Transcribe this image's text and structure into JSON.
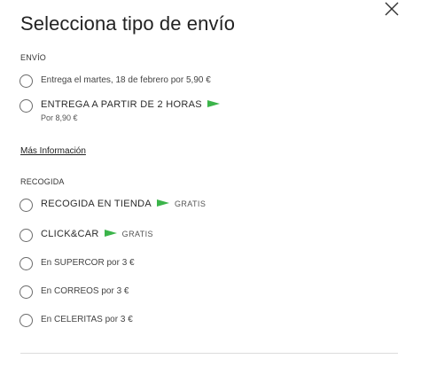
{
  "modal": {
    "title": "Selecciona tipo de envío",
    "close_icon": "close-icon"
  },
  "envio": {
    "section_label": "ENVÍO",
    "options": [
      {
        "label": "Entrega el martes, 18 de febrero por 5,90 €"
      },
      {
        "label": "ENTREGA A PARTIR DE 2 HORAS",
        "icon": "green-flag-icon",
        "subtext": "Por 8,90 €"
      }
    ],
    "more_info": "Más Información"
  },
  "recogida": {
    "section_label": "RECOGIDA",
    "options": [
      {
        "label": "RECOGIDA EN TIENDA",
        "icon": "green-flag-icon",
        "badge": "GRATIS"
      },
      {
        "label": "CLICK&CAR",
        "icon": "green-flag-icon",
        "badge": "GRATIS"
      },
      {
        "label": "En SUPERCOR por 3 €"
      },
      {
        "label": "En CORREOS por 3 €"
      },
      {
        "label": "En CELERITAS por 3 €"
      }
    ]
  },
  "colors": {
    "accent_flag": "#3bb44a",
    "radio_border": "#6b6b6b"
  }
}
